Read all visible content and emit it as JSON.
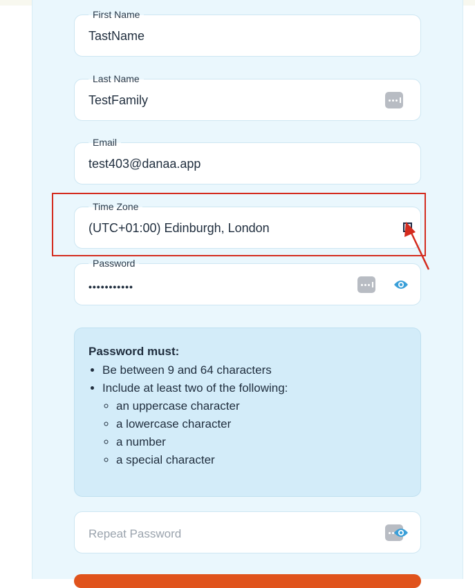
{
  "form": {
    "first_name": {
      "label": "First Name",
      "value": "TastName"
    },
    "last_name": {
      "label": "Last Name",
      "value": "TestFamily"
    },
    "email": {
      "label": "Email",
      "value": "test403@danaa.app"
    },
    "time_zone": {
      "label": "Time Zone",
      "value": "(UTC+01:00) Edinburgh, London"
    },
    "password": {
      "label": "Password",
      "value": "•••••••••••"
    },
    "repeat_password": {
      "placeholder": "Repeat Password"
    }
  },
  "rules": {
    "heading": "Password must:",
    "items": [
      "Be between 9 and 64 characters",
      "Include at least two of the following:"
    ],
    "subitems": [
      "an uppercase character",
      "a lowercase character",
      "a number",
      "a special character"
    ]
  },
  "colors": {
    "panel": "#eaf7fd",
    "rules_box": "#d3ecf9",
    "highlight": "#d42b1e",
    "submit": "#e0531c",
    "eye_icon": "#3a9fd8"
  },
  "icons": [
    "password-manager-icon",
    "eye-icon",
    "dropdown-icon",
    "annotation-arrow"
  ]
}
